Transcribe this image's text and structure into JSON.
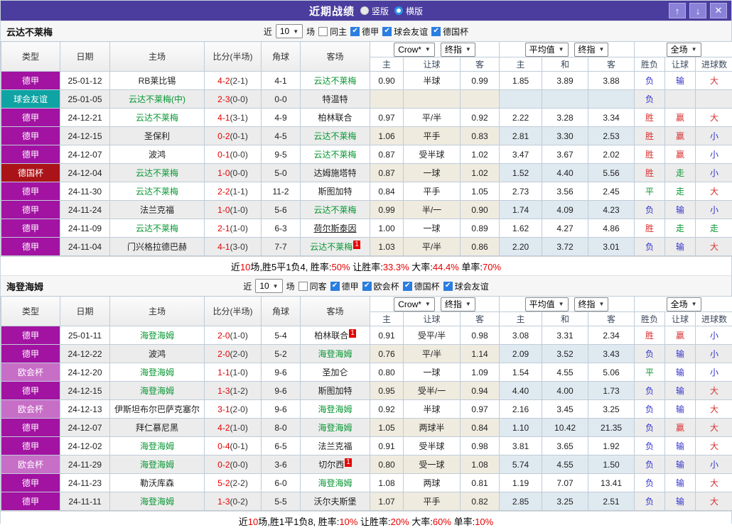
{
  "titlebar": {
    "title": "近期战绩",
    "radio_vertical": "竖版",
    "radio_horizontal": "横版",
    "selected_layout": "竖版",
    "up_button": "↑",
    "down_button": "↓",
    "close_button": "✕"
  },
  "colors": {
    "topbar": "#4a3d9e",
    "type_bg": {
      "德甲": "#a213a2",
      "球会友谊": "#0fa3a3",
      "德国杯": "#aa1318",
      "欧会杯": "#c76ec7"
    },
    "team_green": "#089733",
    "score_red": "#e60000",
    "result_red": "#d93030",
    "result_blue": "#3333cc",
    "result_green": "#089733",
    "checkbox_blue": "#2b7de1"
  },
  "table_header": {
    "left": [
      "类型",
      "日期",
      "主场",
      "比分(半场)",
      "角球",
      "客场"
    ],
    "dropdown_groups": [
      [
        "Crow*",
        "终指"
      ],
      [
        "平均值",
        "终指"
      ],
      [
        "全场"
      ]
    ],
    "sub": [
      "主",
      "让球",
      "客",
      "主",
      "和",
      "客",
      "胜负",
      "让球",
      "进球数"
    ]
  },
  "sections": [
    {
      "team": "云达不莱梅",
      "filter": {
        "prefix": "近",
        "count": "10",
        "suffix": "场",
        "checks": [
          {
            "label": "同主",
            "checked": false
          },
          {
            "label": "德甲",
            "checked": true
          },
          {
            "label": "球会友谊",
            "checked": true
          },
          {
            "label": "德国杯",
            "checked": true
          }
        ]
      },
      "rows": [
        {
          "type": "德甲",
          "date": "25-01-12",
          "home": "RB莱比锡",
          "score": "4-2",
          "half": "(2-1)",
          "corner": "4-1",
          "away": "云达不莱梅",
          "odds": [
            "0.90",
            "半球",
            "0.99",
            "1.85",
            "3.89",
            "3.88"
          ],
          "results": [
            "负",
            "输",
            "大"
          ]
        },
        {
          "type": "球会友谊",
          "date": "25-01-05",
          "home": "云达不莱梅(中)",
          "score": "2-3",
          "half": "(0-0)",
          "corner": "0-0",
          "away": "特温特",
          "odds": [
            "",
            "",
            "",
            "",
            "",
            ""
          ],
          "results": [
            "负",
            "",
            ""
          ]
        },
        {
          "type": "德甲",
          "date": "24-12-21",
          "home": "云达不莱梅",
          "score": "4-1",
          "half": "(3-1)",
          "corner": "4-9",
          "away": "柏林联合",
          "odds": [
            "0.97",
            "平/半",
            "0.92",
            "2.22",
            "3.28",
            "3.34"
          ],
          "results": [
            "胜",
            "赢",
            "大"
          ]
        },
        {
          "type": "德甲",
          "date": "24-12-15",
          "home": "圣保利",
          "score": "0-2",
          "half": "(0-1)",
          "corner": "4-5",
          "away": "云达不莱梅",
          "odds": [
            "1.06",
            "平手",
            "0.83",
            "2.81",
            "3.30",
            "2.53"
          ],
          "results": [
            "胜",
            "赢",
            "小"
          ]
        },
        {
          "type": "德甲",
          "date": "24-12-07",
          "home": "波鸿",
          "score": "0-1",
          "half": "(0-0)",
          "corner": "9-5",
          "away": "云达不莱梅",
          "odds": [
            "0.87",
            "受半球",
            "1.02",
            "3.47",
            "3.67",
            "2.02"
          ],
          "results": [
            "胜",
            "赢",
            "小"
          ]
        },
        {
          "type": "德国杯",
          "date": "24-12-04",
          "home": "云达不莱梅",
          "score": "1-0",
          "half": "(0-0)",
          "corner": "5-0",
          "away": "达姆施塔特",
          "odds": [
            "0.87",
            "一球",
            "1.02",
            "1.52",
            "4.40",
            "5.56"
          ],
          "results": [
            "胜",
            "走",
            "小"
          ]
        },
        {
          "type": "德甲",
          "date": "24-11-30",
          "home": "云达不莱梅",
          "score": "2-2",
          "half": "(1-1)",
          "corner": "11-2",
          "away": "斯图加特",
          "odds": [
            "0.84",
            "平手",
            "1.05",
            "2.73",
            "3.56",
            "2.45"
          ],
          "results": [
            "平",
            "走",
            "大"
          ]
        },
        {
          "type": "德甲",
          "date": "24-11-24",
          "home": "法兰克福",
          "score": "1-0",
          "half": "(1-0)",
          "corner": "5-6",
          "away": "云达不莱梅",
          "odds": [
            "0.99",
            "半/一",
            "0.90",
            "1.74",
            "4.09",
            "4.23"
          ],
          "results": [
            "负",
            "输",
            "小"
          ]
        },
        {
          "type": "德甲",
          "date": "24-11-09",
          "home": "云达不莱梅",
          "score": "2-1",
          "half": "(1-0)",
          "corner": "6-3",
          "away": "荷尔斯泰因",
          "away_u": true,
          "odds": [
            "1.00",
            "一球",
            "0.89",
            "1.62",
            "4.27",
            "4.86"
          ],
          "results": [
            "胜",
            "走",
            "走"
          ]
        },
        {
          "type": "德甲",
          "date": "24-11-04",
          "home": "门兴格拉德巴赫",
          "score": "4-1",
          "half": "(3-0)",
          "corner": "7-7",
          "away": "云达不莱梅",
          "away_badge": "1",
          "odds": [
            "1.03",
            "平/半",
            "0.86",
            "2.20",
            "3.72",
            "3.01"
          ],
          "results": [
            "负",
            "输",
            "大"
          ]
        }
      ],
      "summary": [
        {
          "t": "近"
        },
        {
          "t": "10",
          "red": true
        },
        {
          "t": "场,胜5平1负4, 胜率:"
        },
        {
          "t": "50%",
          "red": true
        },
        {
          "t": " 让胜率:"
        },
        {
          "t": "33.3%",
          "red": true
        },
        {
          "t": " 大率:"
        },
        {
          "t": "44.4%",
          "red": true
        },
        {
          "t": " 单率:"
        },
        {
          "t": "70%",
          "red": true
        }
      ]
    },
    {
      "team": "海登海姆",
      "filter": {
        "prefix": "近",
        "count": "10",
        "suffix": "场",
        "checks": [
          {
            "label": "同客",
            "checked": false
          },
          {
            "label": "德甲",
            "checked": true
          },
          {
            "label": "欧会杯",
            "checked": true
          },
          {
            "label": "德国杯",
            "checked": true
          },
          {
            "label": "球会友谊",
            "checked": true
          }
        ]
      },
      "rows": [
        {
          "type": "德甲",
          "date": "25-01-11",
          "home": "海登海姆",
          "score": "2-0",
          "half": "(1-0)",
          "corner": "5-4",
          "away": "柏林联合",
          "away_badge": "1",
          "odds": [
            "0.91",
            "受平/半",
            "0.98",
            "3.08",
            "3.31",
            "2.34"
          ],
          "results": [
            "胜",
            "赢",
            "小"
          ]
        },
        {
          "type": "德甲",
          "date": "24-12-22",
          "home": "波鸿",
          "score": "2-0",
          "half": "(2-0)",
          "corner": "5-2",
          "away": "海登海姆",
          "odds": [
            "0.76",
            "平/半",
            "1.14",
            "2.09",
            "3.52",
            "3.43"
          ],
          "results": [
            "负",
            "输",
            "小"
          ]
        },
        {
          "type": "欧会杯",
          "date": "24-12-20",
          "home": "海登海姆",
          "score": "1-1",
          "half": "(1-0)",
          "corner": "9-6",
          "away": "圣加仑",
          "odds": [
            "0.80",
            "一球",
            "1.09",
            "1.54",
            "4.55",
            "5.06"
          ],
          "results": [
            "平",
            "输",
            "小"
          ]
        },
        {
          "type": "德甲",
          "date": "24-12-15",
          "home": "海登海姆",
          "score": "1-3",
          "half": "(1-2)",
          "corner": "9-6",
          "away": "斯图加特",
          "odds": [
            "0.95",
            "受半/一",
            "0.94",
            "4.40",
            "4.00",
            "1.73"
          ],
          "results": [
            "负",
            "输",
            "大"
          ]
        },
        {
          "type": "欧会杯",
          "date": "24-12-13",
          "home": "伊斯坦布尔巴萨克塞尔",
          "score": "3-1",
          "half": "(2-0)",
          "corner": "9-6",
          "away": "海登海姆",
          "odds": [
            "0.92",
            "半球",
            "0.97",
            "2.16",
            "3.45",
            "3.25"
          ],
          "results": [
            "负",
            "输",
            "大"
          ]
        },
        {
          "type": "德甲",
          "date": "24-12-07",
          "home": "拜仁慕尼黑",
          "score": "4-2",
          "half": "(1-0)",
          "corner": "8-0",
          "away": "海登海姆",
          "odds": [
            "1.05",
            "两球半",
            "0.84",
            "1.10",
            "10.42",
            "21.35"
          ],
          "results": [
            "负",
            "赢",
            "大"
          ]
        },
        {
          "type": "德甲",
          "date": "24-12-02",
          "home": "海登海姆",
          "score": "0-4",
          "half": "(0-1)",
          "corner": "6-5",
          "away": "法兰克福",
          "odds": [
            "0.91",
            "受半球",
            "0.98",
            "3.81",
            "3.65",
            "1.92"
          ],
          "results": [
            "负",
            "输",
            "大"
          ]
        },
        {
          "type": "欧会杯",
          "date": "24-11-29",
          "home": "海登海姆",
          "score": "0-2",
          "half": "(0-0)",
          "corner": "3-6",
          "away": "切尔西",
          "away_badge": "1",
          "odds": [
            "0.80",
            "受一球",
            "1.08",
            "5.74",
            "4.55",
            "1.50"
          ],
          "results": [
            "负",
            "输",
            "小"
          ]
        },
        {
          "type": "德甲",
          "date": "24-11-23",
          "home": "勒沃库森",
          "score": "5-2",
          "half": "(2-2)",
          "corner": "6-0",
          "away": "海登海姆",
          "odds": [
            "1.08",
            "两球",
            "0.81",
            "1.19",
            "7.07",
            "13.41"
          ],
          "results": [
            "负",
            "输",
            "大"
          ]
        },
        {
          "type": "德甲",
          "date": "24-11-11",
          "home": "海登海姆",
          "score": "1-3",
          "half": "(0-2)",
          "corner": "5-5",
          "away": "沃尔夫斯堡",
          "odds": [
            "1.07",
            "平手",
            "0.82",
            "2.85",
            "3.25",
            "2.51"
          ],
          "results": [
            "负",
            "输",
            "大"
          ]
        }
      ],
      "summary": [
        {
          "t": "近"
        },
        {
          "t": "10",
          "red": true
        },
        {
          "t": "场,胜1平1负8, 胜率:"
        },
        {
          "t": "10%",
          "red": true
        },
        {
          "t": " 让胜率:"
        },
        {
          "t": "20%",
          "red": true
        },
        {
          "t": " 大率:"
        },
        {
          "t": "60%",
          "red": true
        },
        {
          "t": " 单率:"
        },
        {
          "t": "10%",
          "red": true
        }
      ]
    }
  ]
}
